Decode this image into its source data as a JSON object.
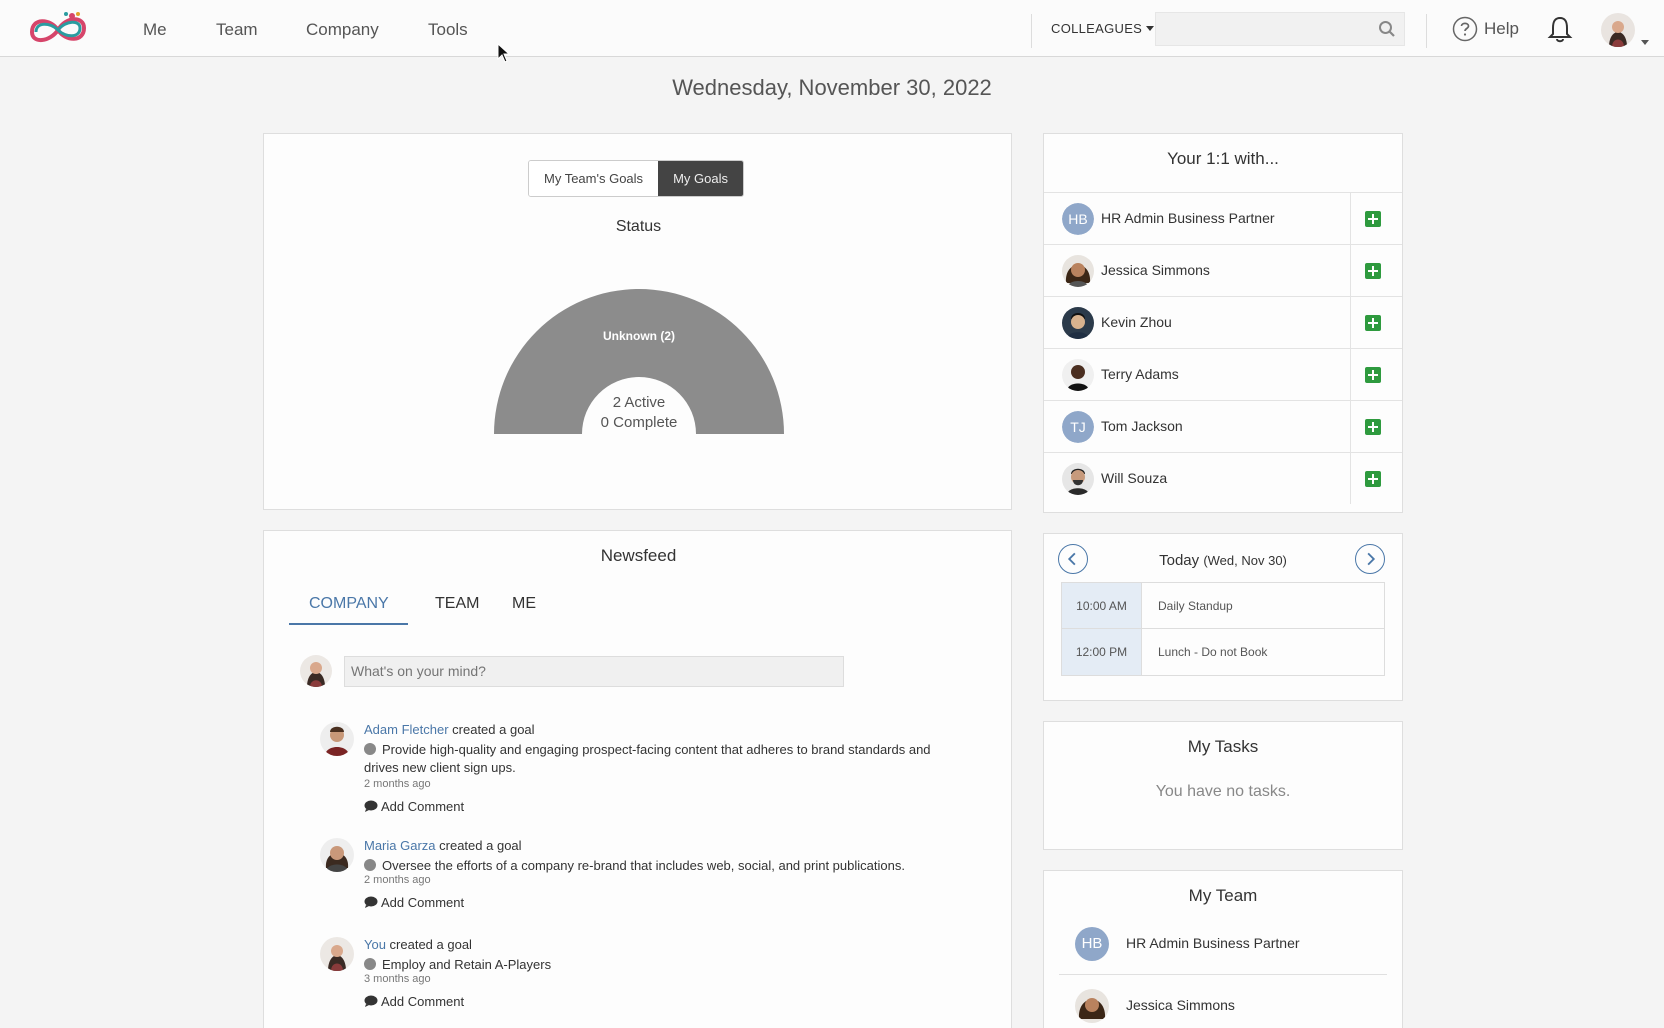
{
  "nav": {
    "links": [
      "Me",
      "Team",
      "Company",
      "Tools"
    ],
    "colleagues_label": "COLLEAGUES",
    "search_placeholder": "",
    "help_label": "Help"
  },
  "date_heading": "Wednesday, November 30, 2022",
  "goals": {
    "toggle": [
      "My Team's Goals",
      "My Goals"
    ],
    "selected_toggle": "My Goals",
    "status_title": "Status",
    "gauge_segment_label": "Unknown (2)",
    "active_label": "2 Active",
    "complete_label": "0 Complete",
    "colors": {
      "unknown": "#8c8c8c"
    }
  },
  "newsfeed": {
    "title": "Newsfeed",
    "tabs": [
      "COMPANY",
      "TEAM",
      "ME"
    ],
    "active_tab": "COMPANY",
    "post_placeholder": "What's on your mind?",
    "items": [
      {
        "author": "Adam Fletcher",
        "action": " created a goal",
        "goal": "Provide high-quality and engaging prospect-facing content that adheres to brand standards and drives new client sign ups.",
        "time": "2 months ago",
        "comment_label": "Add Comment"
      },
      {
        "author": "Maria Garza",
        "action": " created a goal",
        "goal": "Oversee the efforts of a company re-brand that includes web, social, and print publications.",
        "time": "2 months ago",
        "comment_label": "Add Comment"
      },
      {
        "author": "You",
        "action": " created a goal",
        "goal": "Employ and Retain A-Players",
        "time": "3 months ago",
        "comment_label": "Add Comment"
      }
    ]
  },
  "oneone": {
    "title": "Your 1:1 with...",
    "people": [
      {
        "name": "HR Admin Business Partner",
        "initials": "HB"
      },
      {
        "name": "Jessica Simmons",
        "initials": ""
      },
      {
        "name": "Kevin Zhou",
        "initials": ""
      },
      {
        "name": "Terry Adams",
        "initials": ""
      },
      {
        "name": "Tom Jackson",
        "initials": "TJ"
      },
      {
        "name": "Will Souza",
        "initials": ""
      }
    ]
  },
  "calendar": {
    "title": "Today",
    "title_date": "(Wed, Nov 30)",
    "events": [
      {
        "time": "10:00 AM",
        "label": "Daily Standup"
      },
      {
        "time": "12:00 PM",
        "label": "Lunch - Do not Book"
      }
    ]
  },
  "tasks": {
    "title": "My Tasks",
    "empty": "You have no tasks."
  },
  "team": {
    "title": "My Team",
    "members": [
      {
        "name": "HR Admin Business Partner",
        "initials": "HB"
      },
      {
        "name": "Jessica Simmons",
        "initials": ""
      }
    ]
  }
}
